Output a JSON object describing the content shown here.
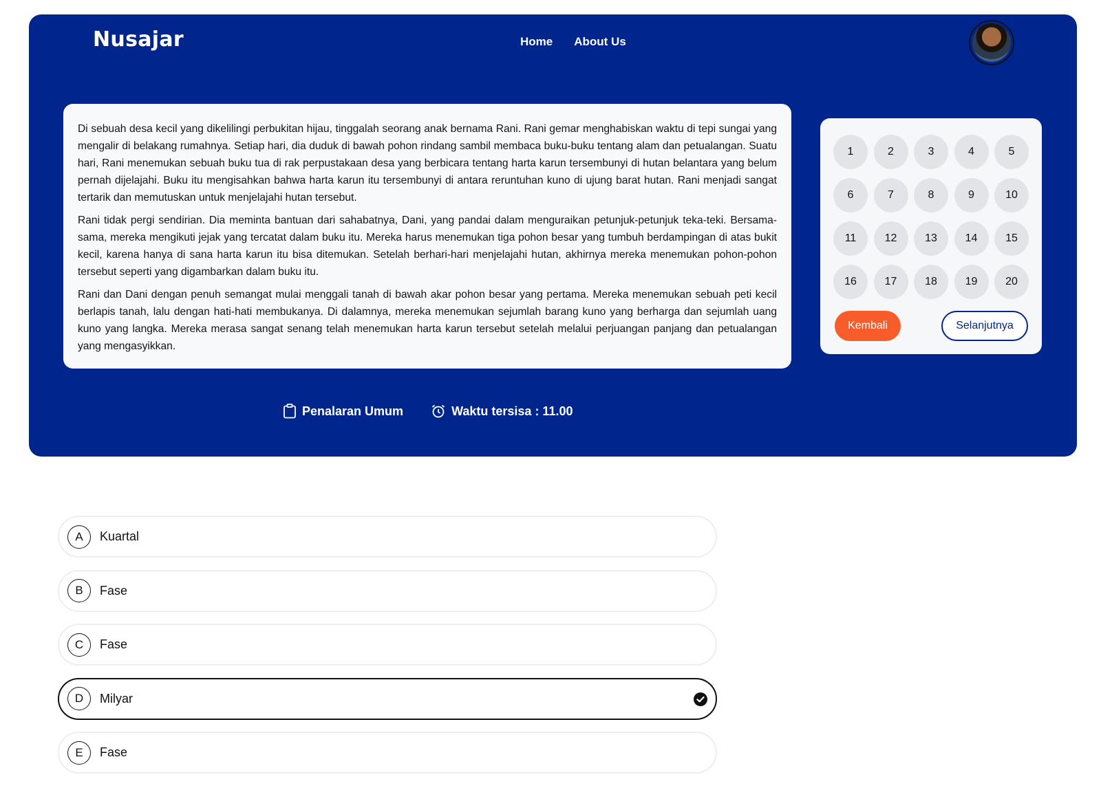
{
  "header": {
    "brand": "Nusajar",
    "nav": [
      {
        "label": "Home"
      },
      {
        "label": "About Us"
      }
    ],
    "avatar_icon": "user-avatar"
  },
  "passage": {
    "paragraphs": [
      "Di sebuah desa kecil yang dikelilingi perbukitan hijau, tinggalah seorang anak bernama Rani. Rani gemar menghabiskan waktu di tepi sungai yang mengalir di belakang rumahnya. Setiap hari, dia duduk di bawah pohon rindang sambil membaca buku-buku tentang alam dan petualangan. Suatu hari, Rani menemukan sebuah buku tua di rak perpustakaan desa yang berbicara tentang harta karun tersembunyi di hutan belantara yang belum pernah dijelajahi. Buku itu mengisahkan bahwa harta karun itu tersembunyi di antara reruntuhan kuno di ujung barat hutan. Rani menjadi sangat tertarik dan memutuskan untuk menjelajahi hutan tersebut.",
      "Rani tidak pergi sendirian. Dia meminta bantuan dari sahabatnya, Dani, yang pandai dalam menguraikan petunjuk-petunjuk teka-teki. Bersama-sama, mereka mengikuti jejak yang tercatat dalam buku itu. Mereka harus menemukan tiga pohon besar yang tumbuh berdampingan di atas bukit kecil, karena hanya di sana harta karun itu bisa ditemukan. Setelah berhari-hari menjelajahi hutan, akhirnya mereka menemukan pohon-pohon tersebut seperti yang digambarkan dalam buku itu.",
      "Rani dan Dani dengan penuh semangat mulai menggali tanah di bawah akar pohon besar yang pertama. Mereka menemukan sebuah peti kecil berlapis tanah, lalu dengan hati-hati membukanya. Di dalamnya, mereka menemukan sejumlah barang kuno yang berharga dan sejumlah uang kuno yang langka. Mereka merasa sangat senang telah menemukan harta karun tersebut setelah melalui perjuangan panjang dan petualangan yang mengasyikkan."
    ]
  },
  "question_nav": {
    "numbers": [
      "1",
      "2",
      "3",
      "4",
      "5",
      "6",
      "7",
      "8",
      "9",
      "10",
      "11",
      "12",
      "13",
      "14",
      "15",
      "16",
      "17",
      "18",
      "19",
      "20"
    ],
    "back_label": "Kembali",
    "next_label": "Selanjutnya"
  },
  "info": {
    "category": "Penalaran Umum",
    "category_icon": "clipboard-icon",
    "timer": "Waktu tersisa : 11.00",
    "timer_icon": "alarm-clock-icon"
  },
  "options": [
    {
      "letter": "A",
      "label": "Kuartal",
      "selected": false
    },
    {
      "letter": "B",
      "label": "Fase",
      "selected": false
    },
    {
      "letter": "C",
      "label": "Fase",
      "selected": false
    },
    {
      "letter": "D",
      "label": "Milyar",
      "selected": true
    },
    {
      "letter": "E",
      "label": "Fase",
      "selected": false
    }
  ],
  "colors": {
    "primary": "#00258c",
    "accent": "#f85c2b",
    "panel": "#f8f9fb"
  }
}
